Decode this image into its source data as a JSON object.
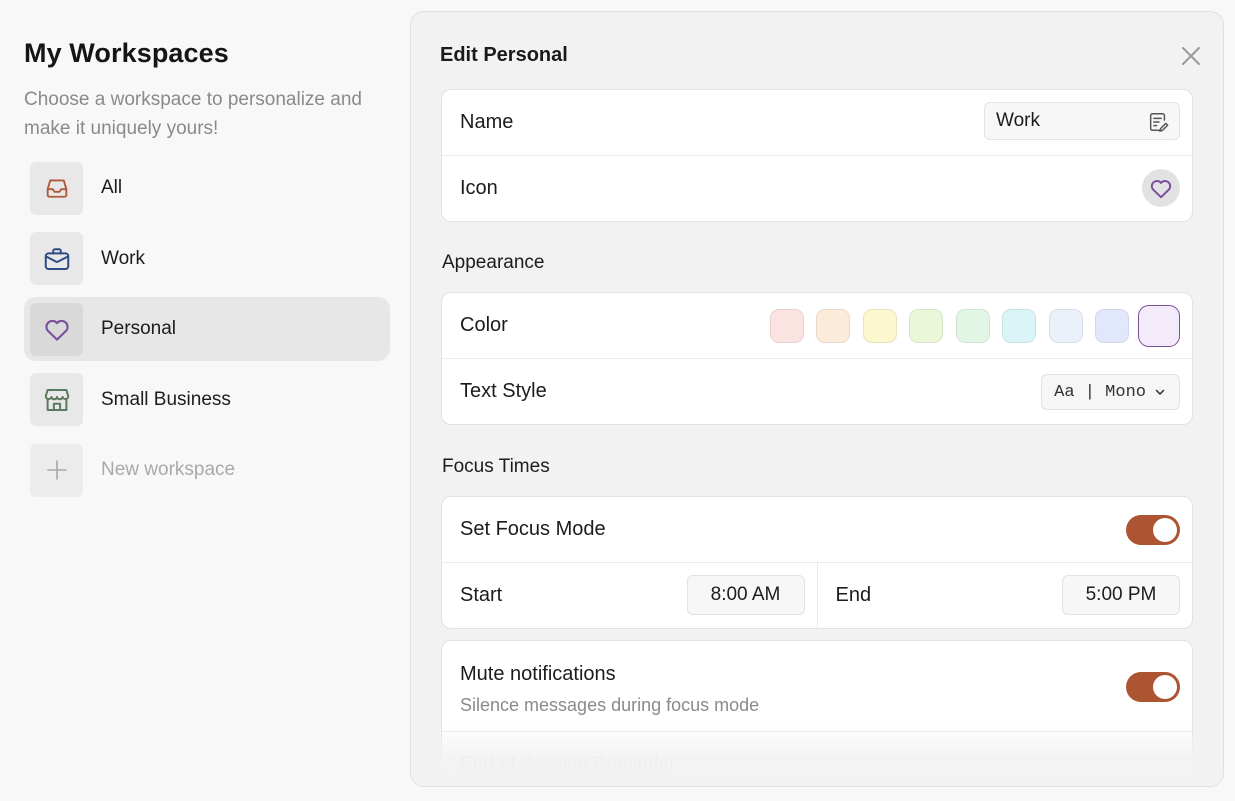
{
  "sidebar": {
    "title": "My Workspaces",
    "description": "Choose a workspace to personalize and make it uniquely yours!",
    "items": [
      {
        "label": "All",
        "icon": "inbox-icon",
        "color": "#b0583a"
      },
      {
        "label": "Work",
        "icon": "briefcase-icon",
        "color": "#2e4b86"
      },
      {
        "label": "Personal",
        "icon": "heart-icon",
        "color": "#7a4f9c",
        "selected": true
      },
      {
        "label": "Small Business",
        "icon": "storefront-icon",
        "color": "#5a7a5e"
      }
    ],
    "new_label": "New workspace"
  },
  "panel": {
    "title": "Edit Personal",
    "name_label": "Name",
    "name_value": "Work",
    "icon_label": "Icon",
    "appearance_heading": "Appearance",
    "color_label": "Color",
    "colors": [
      "#fbe3e1",
      "#fdebda",
      "#fdf7cf",
      "#ebf7d9",
      "#e2f6e5",
      "#d9f5f7",
      "#ebf1fb",
      "#e2e8fb",
      "#f3eafa"
    ],
    "selected_color": "#f3eafa",
    "text_style_label": "Text Style",
    "text_style_value": "Aa | Mono",
    "focus_heading": "Focus Times",
    "focus_mode_label": "Set Focus Mode",
    "focus_mode_on": true,
    "start_label": "Start",
    "start_value": "8:00 AM",
    "end_label": "End",
    "end_value": "5:00 PM",
    "mute_label": "Mute notifications",
    "mute_desc": "Silence messages during focus mode",
    "mute_on": true,
    "next_label": "End of Session Reminder"
  },
  "colors": {
    "accent": "#ad5532",
    "selected_border": "#7a4f9c"
  }
}
